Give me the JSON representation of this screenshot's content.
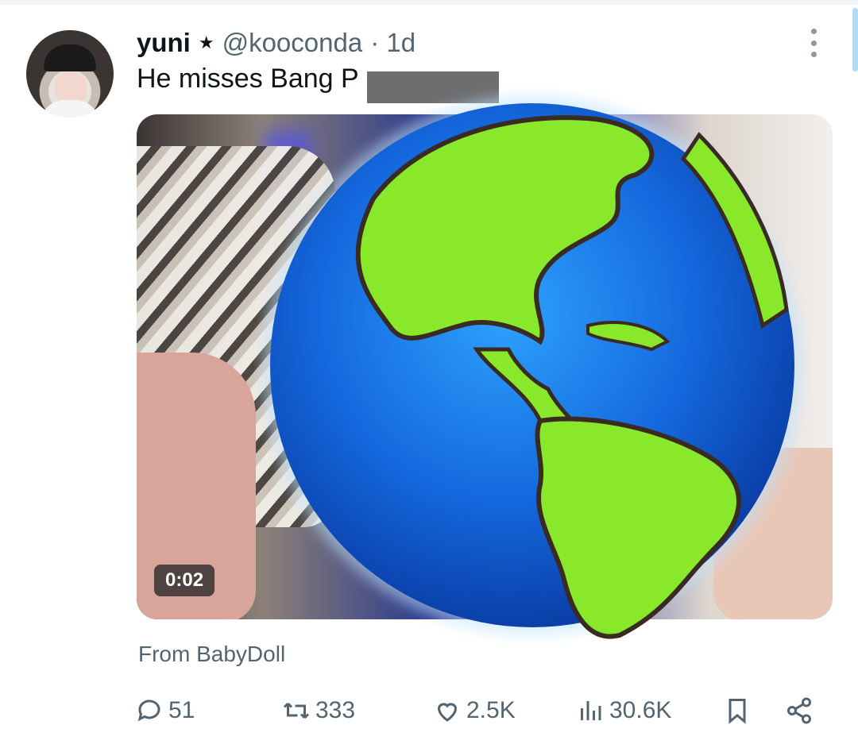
{
  "tweet": {
    "display_name": "yuni",
    "badge": "★",
    "handle": "@kooconda",
    "time": "· 1d",
    "text": "He misses Bang P",
    "video_duration": "0:02",
    "source_label": "From BabyDoll"
  },
  "actions": {
    "replies": "51",
    "reposts": "333",
    "likes": "2.5K",
    "views": "30.6K"
  },
  "icons": {
    "more": "more-vertical-icon",
    "reply": "reply-icon",
    "repost": "repost-icon",
    "like": "heart-icon",
    "views": "views-icon",
    "bookmark": "bookmark-icon",
    "share": "share-icon"
  },
  "colors": {
    "text_primary": "#0f1419",
    "text_secondary": "#536471",
    "globe_ocean": "#1a6fe0",
    "globe_land": "#7ed321"
  }
}
